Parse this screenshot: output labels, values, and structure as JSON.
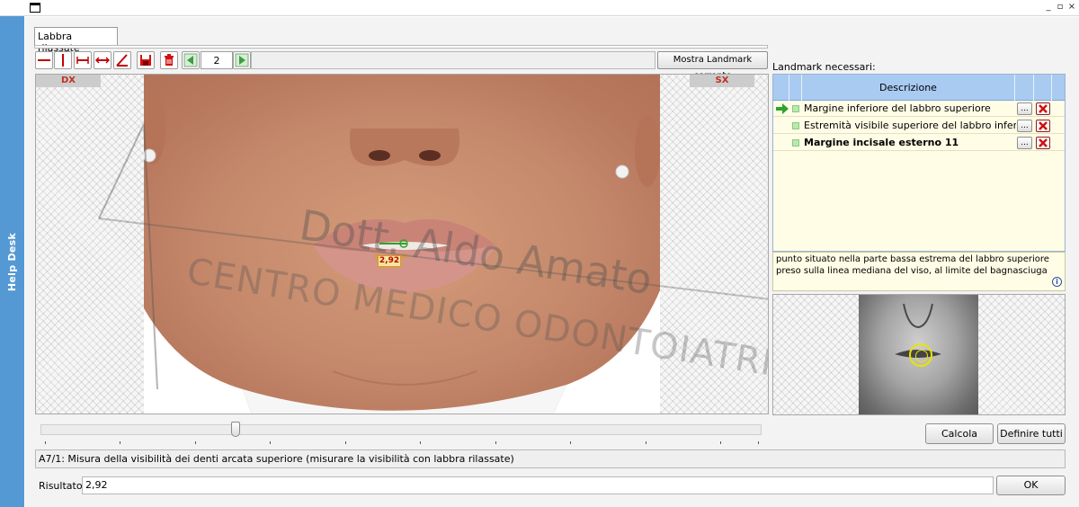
{
  "window": {
    "controls": [
      "_",
      "▫",
      "×"
    ]
  },
  "sidebar": {
    "label": "Help Desk"
  },
  "tab": {
    "label": "Labbra rilassate"
  },
  "toolbar": {
    "page_value": "2",
    "show_landmark_label": "Mostra Landmark corrente"
  },
  "image": {
    "left_label": "DX",
    "right_label": "SX",
    "measure_value": "2,92",
    "watermark_line1": "Dott. Aldo Amato",
    "watermark_line2": "CENTRO MEDICO ODONTOIATRICO"
  },
  "slider": {
    "value": 0.27
  },
  "landmarks": {
    "title": "Landmark necessari:",
    "column_header": "Descrizione",
    "rows": [
      {
        "label": "Margine inferiore del labbro superiore",
        "current": true,
        "bold": false
      },
      {
        "label": "Estremità visibile superiore del labbro infer",
        "current": false,
        "bold": false
      },
      {
        "label": "Margine incisale esterno 11",
        "current": false,
        "bold": true
      }
    ],
    "dots_label": "...",
    "info_text": "punto situato nella parte bassa estrema del labbro superiore preso sulla linea mediana del viso, al limite del bagnasciuga",
    "info_icon": "i"
  },
  "buttons": {
    "calcola": "Calcola",
    "definire": "Definire tutti",
    "ok": "OK"
  },
  "description": "A7/1: Misura della visibilità dei denti arcata superiore (misurare la visibilità con labbra rilassate)",
  "result": {
    "label": "Risultato:",
    "value": "2,92"
  },
  "colors": {
    "sidebar": "#5599d4",
    "table_header": "#a9cbf2",
    "table_body": "#fffde6",
    "landmark_green": "#2fa32a",
    "delete_red": "#d01010",
    "side_label_red": "#c03020"
  }
}
